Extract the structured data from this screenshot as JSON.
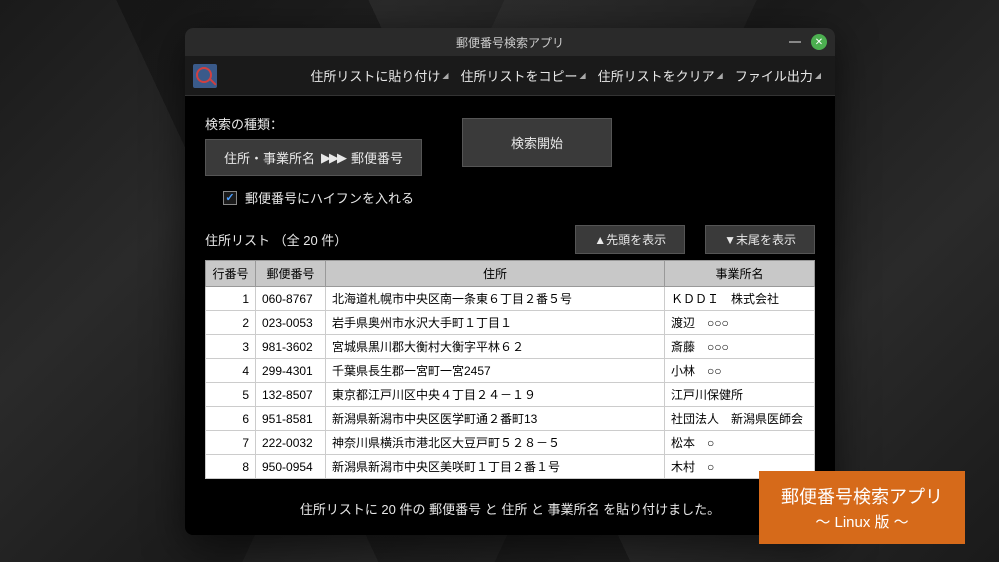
{
  "window": {
    "title": "郵便番号検索アプリ"
  },
  "toolbar": {
    "paste": "住所リストに貼り付け",
    "copy": "住所リストをコピー",
    "clear": "住所リストをクリア",
    "export": "ファイル出力"
  },
  "search": {
    "type_label": "検索の種類：",
    "direction_from": "住所・事業所名",
    "direction_to": "郵便番号",
    "start": "検索開始",
    "hyphen_label": "郵便番号にハイフンを入れる",
    "hyphen_checked": true
  },
  "list": {
    "label": "住所リスト （全 20 件）",
    "top": "▲先頭を表示",
    "bottom": "▼末尾を表示",
    "headers": {
      "row": "行番号",
      "postal": "郵便番号",
      "address": "住所",
      "office": "事業所名"
    },
    "rows": [
      {
        "n": "1",
        "postal": "060-8767",
        "address": "北海道札幌市中央区南一条東６丁目２番５号",
        "office": "ＫＤＤＩ　株式会社"
      },
      {
        "n": "2",
        "postal": "023-0053",
        "address": "岩手県奥州市水沢大手町１丁目１",
        "office": "渡辺　○○○"
      },
      {
        "n": "3",
        "postal": "981-3602",
        "address": "宮城県黒川郡大衡村大衡字平林６２",
        "office": "斎藤　○○○"
      },
      {
        "n": "4",
        "postal": "299-4301",
        "address": "千葉県長生郡一宮町一宮2457",
        "office": "小林　○○"
      },
      {
        "n": "5",
        "postal": "132-8507",
        "address": "東京都江戸川区中央４丁目２４－１９",
        "office": "江戸川保健所"
      },
      {
        "n": "6",
        "postal": "951-8581",
        "address": "新潟県新潟市中央区医学町通２番町13",
        "office": "社団法人　新潟県医師会"
      },
      {
        "n": "7",
        "postal": "222-0032",
        "address": "神奈川県横浜市港北区大豆戸町５２８－５",
        "office": "松本　○"
      },
      {
        "n": "8",
        "postal": "950-0954",
        "address": "新潟県新潟市中央区美咲町１丁目２番１号",
        "office": "木村　○"
      }
    ]
  },
  "status": "住所リストに 20 件の 郵便番号 と 住所 と 事業所名 を貼り付けました。",
  "badge": {
    "line1": "郵便番号検索アプリ",
    "line2": "～ Linux 版 ～"
  }
}
